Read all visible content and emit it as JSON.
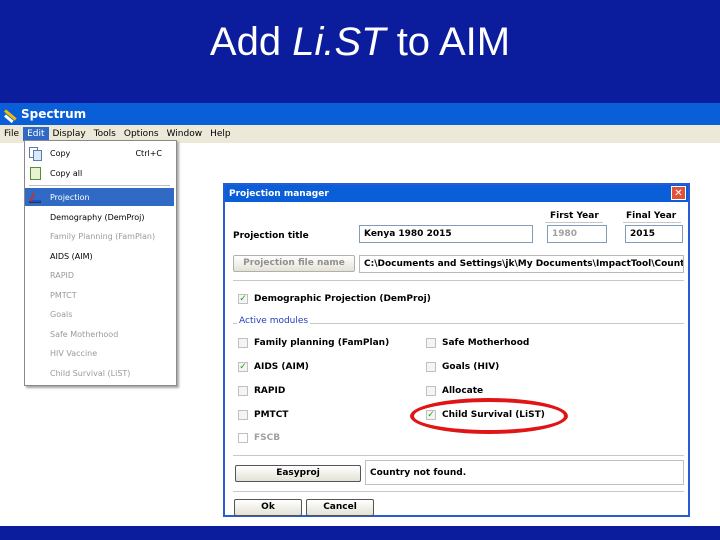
{
  "slide": {
    "title_prefix": "Add ",
    "title_emph": "Li.ST",
    "title_suffix": " to AIM"
  },
  "app": {
    "title": "Spectrum",
    "menus": [
      "File",
      "Edit",
      "Display",
      "Tools",
      "Options",
      "Window",
      "Help"
    ],
    "active_menu": "Edit"
  },
  "edit_menu": {
    "items": [
      {
        "label": "Copy",
        "shortcut": "Ctrl+C",
        "icon": "copy-icon"
      },
      {
        "label": "Copy all",
        "icon": "paste-icon"
      },
      {
        "label": "Projection",
        "icon": "projection-icon",
        "highlight": true
      },
      {
        "label": "Demography (DemProj)"
      },
      {
        "label": "Family Planning (FamPlan)",
        "disabled": true
      },
      {
        "label": "AIDS (AIM)"
      },
      {
        "label": "RAPID",
        "disabled": true
      },
      {
        "label": "PMTCT",
        "disabled": true
      },
      {
        "label": "Goals",
        "disabled": true
      },
      {
        "label": "Safe Motherhood",
        "disabled": true
      },
      {
        "label": "HIV Vaccine",
        "disabled": true
      },
      {
        "label": "Child Survival (LiST)",
        "disabled": true
      }
    ]
  },
  "dialog": {
    "title": "Projection manager",
    "close_glyph": "✕",
    "first_year_label": "First Year",
    "final_year_label": "Final Year",
    "projection_title_label": "Projection title",
    "projection_title_value": "Kenya 1980 2015",
    "first_year_value": "1980",
    "final_year_value": "2015",
    "file_button": "Projection file name",
    "file_path": "C:\\Documents and Settings\\jk\\My Documents\\ImpactTool\\Country",
    "demproj_label": "Demographic Projection (DemProj)",
    "demproj_checked": true,
    "active_modules_label": "Active modules",
    "modules_left": [
      {
        "label": "Family planning (FamPlan)",
        "checked": false
      },
      {
        "label": "AIDS (AIM)",
        "checked": true
      },
      {
        "label": "RAPID",
        "checked": false
      },
      {
        "label": "PMTCT",
        "checked": false
      },
      {
        "label": "FSCB",
        "checked": false,
        "disabled": true
      }
    ],
    "modules_right": [
      {
        "label": "Safe Motherhood",
        "checked": false
      },
      {
        "label": "Goals (HIV)",
        "checked": false
      },
      {
        "label": "Allocate",
        "checked": false
      },
      {
        "label": "Child Survival (LiST)",
        "checked": true
      }
    ],
    "easyproj_button": "Easyproj",
    "status_text": "Country not found.",
    "ok_button": "Ok",
    "cancel_button": "Cancel"
  },
  "colors": {
    "slide_background": "#0b1d9c",
    "titlebar": "#0a5fd8",
    "highlight": "#316ac5",
    "check": "#21a121",
    "annotation_ellipse": "#e01515"
  }
}
